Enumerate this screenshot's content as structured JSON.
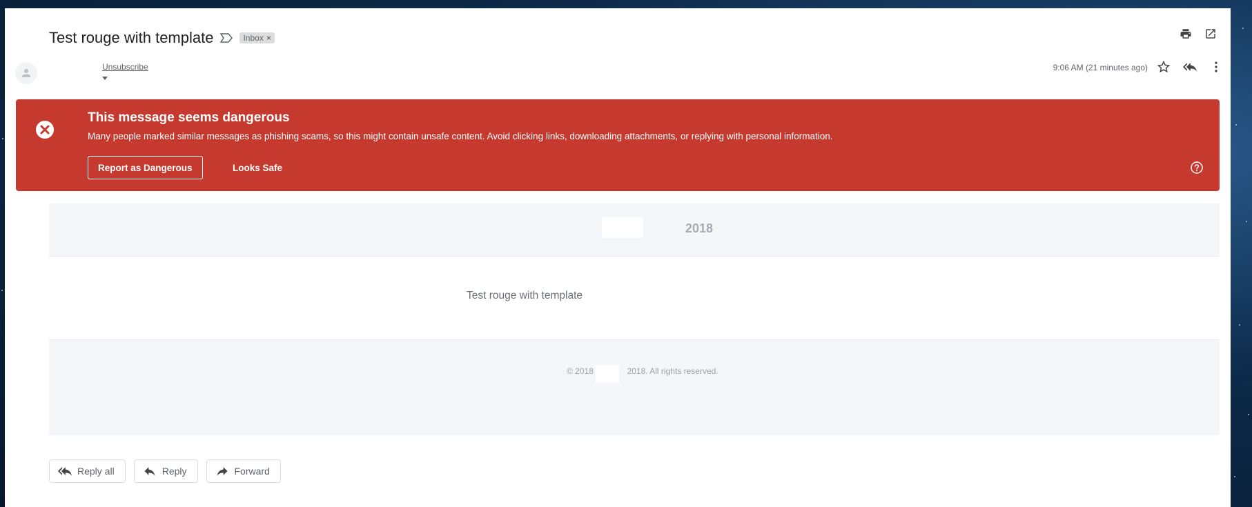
{
  "email": {
    "subject": "Test rouge with template",
    "label": "Inbox",
    "label_remove": "×",
    "sender_link": "Unsubscribe",
    "timestamp": "9:06 AM (21 minutes ago)"
  },
  "warning": {
    "title": "This message seems dangerous",
    "text": "Many people marked similar messages as phishing scams, so this might contain unsafe content. Avoid clicking links, downloading attachments, or replying with personal information.",
    "report_label": "Report as Dangerous",
    "safe_label": "Looks Safe",
    "color": "#c5392e"
  },
  "content": {
    "header_year": "2018",
    "body": "Test rouge with template",
    "footer_prefix": "© 2018",
    "footer_suffix": "2018. All rights reserved."
  },
  "actions": {
    "reply_all": "Reply all",
    "reply": "Reply",
    "forward": "Forward"
  },
  "icons": [
    "print-icon",
    "open-in-new-window-icon",
    "star-icon",
    "reply-all-icon",
    "more-vert-icon",
    "dangerous-icon",
    "help-icon",
    "label-icon",
    "avatar-icon",
    "reply-icon",
    "forward-icon"
  ]
}
